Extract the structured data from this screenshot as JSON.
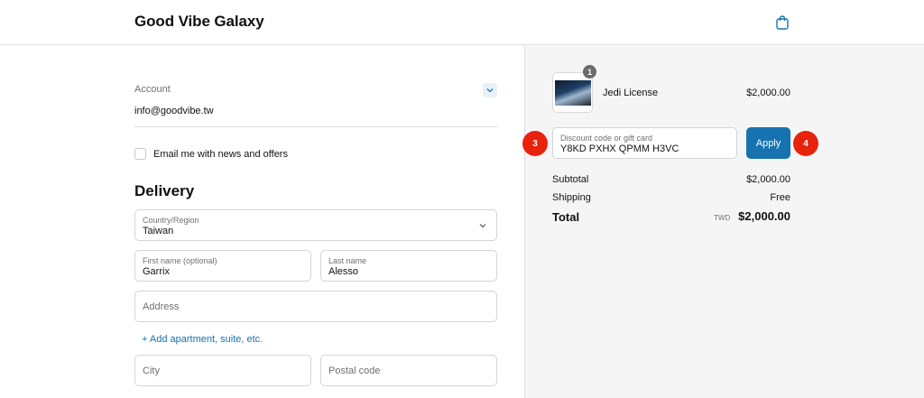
{
  "header": {
    "brand": "Good Vibe Galaxy",
    "cart_icon": "shopping-bag-icon"
  },
  "account": {
    "label": "Account",
    "email": "info@goodvibe.tw",
    "toggle_icon": "chevron-down-icon"
  },
  "newsletter": {
    "checked": false,
    "label": "Email me with news and offers"
  },
  "delivery": {
    "heading": "Delivery",
    "country": {
      "label": "Country/Region",
      "value": "Taiwan"
    },
    "first_name": {
      "label": "First name (optional)",
      "value": "Garrix"
    },
    "last_name": {
      "label": "Last name",
      "value": "Alesso"
    },
    "address": {
      "placeholder": "Address"
    },
    "add_apartment": "+ Add apartment, suite, etc.",
    "city": {
      "placeholder": "City"
    },
    "postal_code": {
      "placeholder": "Postal code"
    }
  },
  "summary": {
    "item": {
      "quantity": "1",
      "name": "Jedi License",
      "price": "$2,000.00"
    },
    "discount": {
      "label": "Discount code or gift card",
      "value": "Y8KD PXHX QPMM H3VC"
    },
    "apply_label": "Apply",
    "subtotal": {
      "label": "Subtotal",
      "value": "$2,000.00"
    },
    "shipping": {
      "label": "Shipping",
      "value": "Free"
    },
    "total": {
      "label": "Total",
      "currency": "TWD",
      "value": "$2,000.00"
    }
  },
  "annotations": {
    "marker_3": "3",
    "marker_4": "4"
  },
  "colors": {
    "accent": "#1773b0",
    "marker": "#e8220c",
    "summary_bg": "#f5f5f5"
  }
}
